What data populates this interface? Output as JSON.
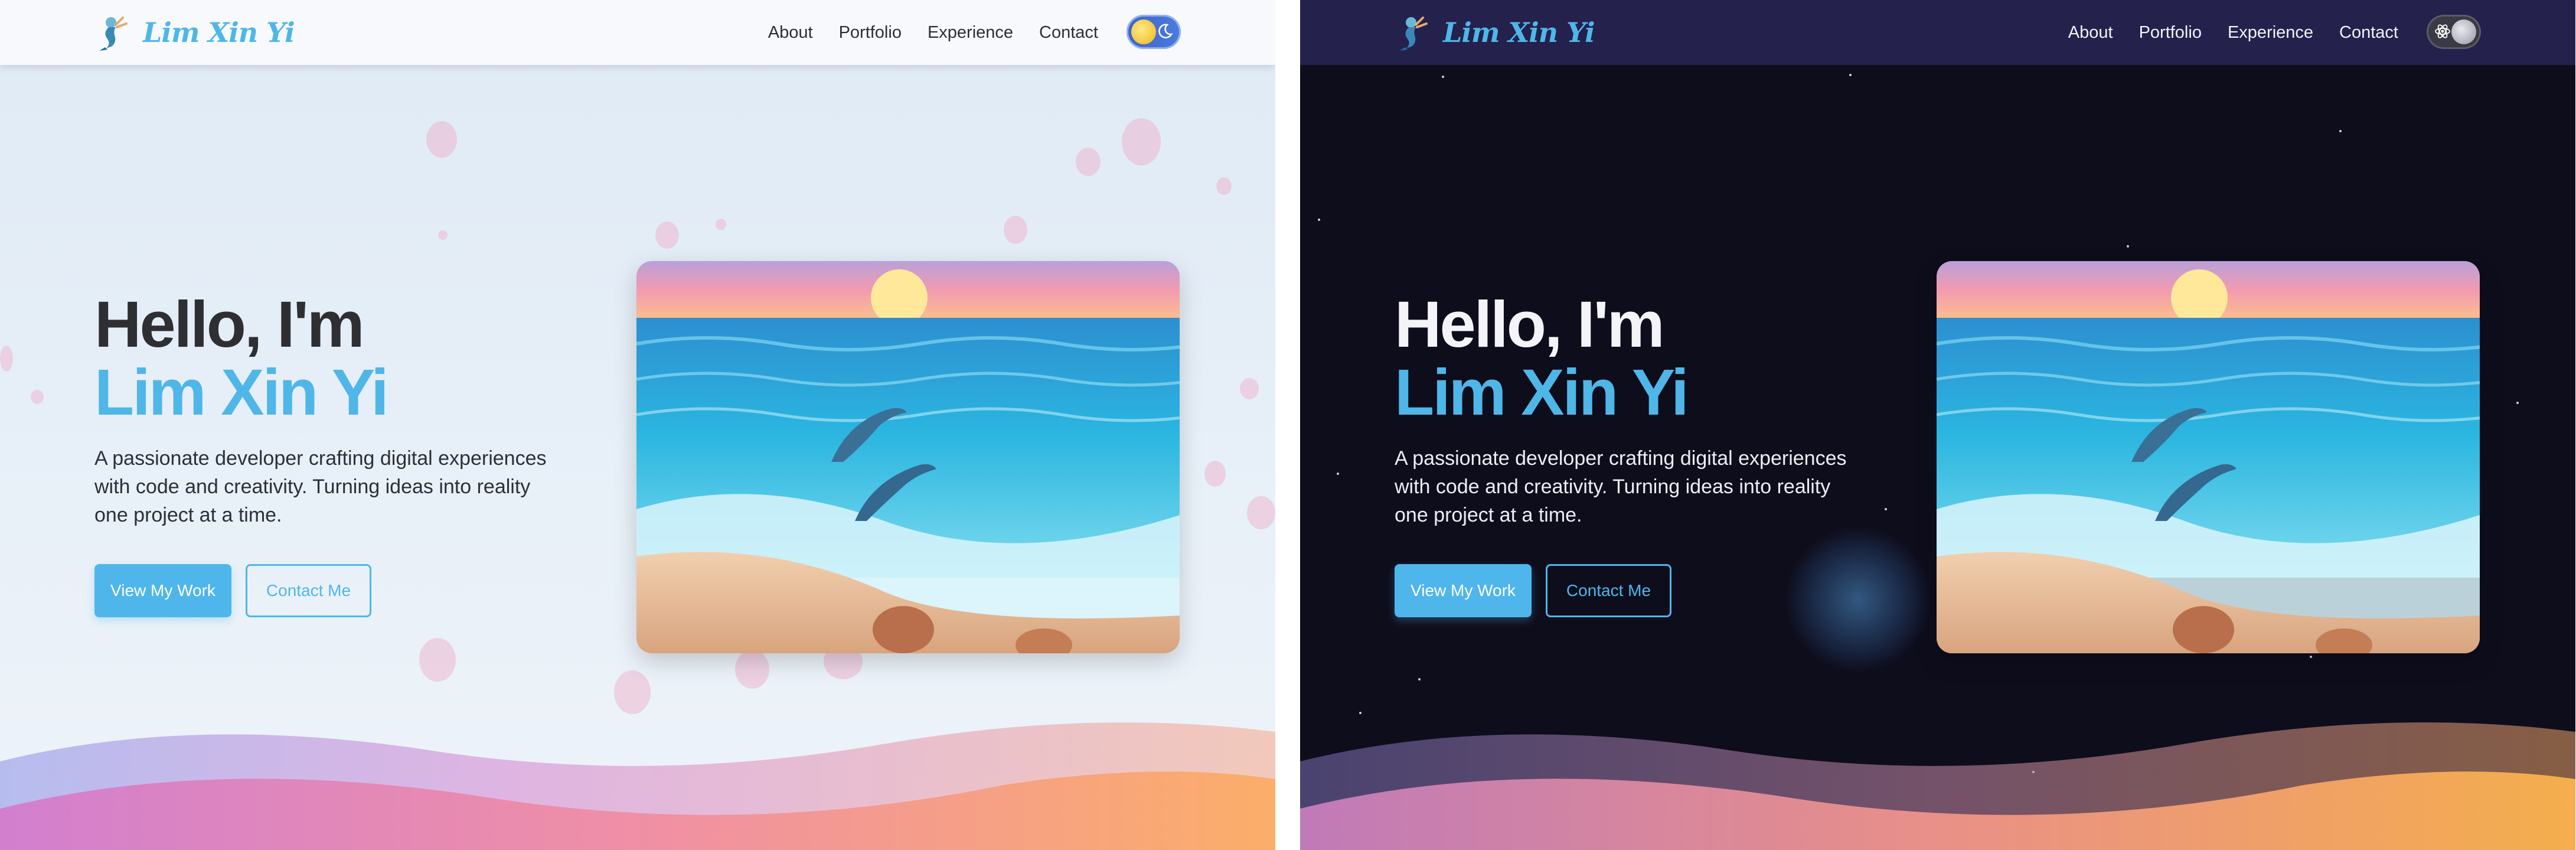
{
  "brand": {
    "name": "Lim Xin Yi",
    "logo_icon": "mermaid-logo-icon"
  },
  "nav": {
    "links": [
      "About",
      "Portfolio",
      "Experience",
      "Contact"
    ]
  },
  "theme_toggle": {
    "light": {
      "knob_icon": "sun-icon",
      "other_icon": "moon-icon"
    },
    "dark": {
      "knob_icon": "moon-icon",
      "other_icon": "atom-icon"
    }
  },
  "hero": {
    "greeting": "Hello, I'm",
    "name": "Lim Xin Yi",
    "description": "A passionate developer crafting digital experiences with code and creativity. Turning ideas into reality one project at a time.",
    "primary_button": "View My Work",
    "secondary_button": "Contact Me",
    "image_subject": "dolphins-ocean-sunset-illustration"
  },
  "colors": {
    "accent": "#4fb6e8",
    "light_background": "#e4edf7",
    "dark_background": "#0e0d1c",
    "dark_navbar": "#24214d"
  }
}
